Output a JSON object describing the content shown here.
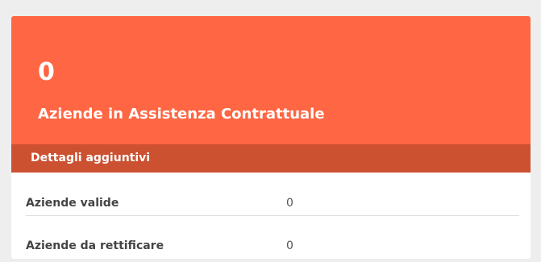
{
  "widget": {
    "count": "0",
    "title": "Aziende in Assistenza Contrattuale",
    "details_title": "Dettagli aggiuntivi",
    "rows": [
      {
        "label": "Aziende valide",
        "value": "0"
      },
      {
        "label": "Aziende da rettificare",
        "value": "0"
      }
    ],
    "colors": {
      "header": "#ff6643",
      "details_bar": "#cc5131"
    }
  }
}
